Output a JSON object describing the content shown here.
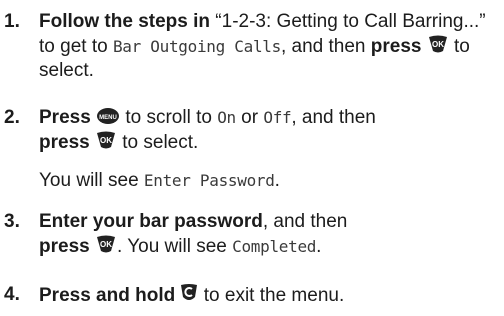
{
  "steps": [
    {
      "num": "1.",
      "lead": "Follow the steps in",
      "ref": "“1-2-3: Getting to Call Barring...” to get to",
      "screen": "Bar Outgoing Calls",
      "after_screen": ",",
      "line3a": "and then",
      "press": "press",
      "tail": "to select."
    },
    {
      "num": "2.",
      "press": "Press",
      "mid": "to scroll to",
      "opt_on": "On",
      "or": "or",
      "opt_off": "Off",
      "then": ", and then",
      "press2": "press",
      "tail": "to select."
    },
    {
      "num": "3.",
      "lead": "Enter your bar password",
      "then": ", and then",
      "press": "press",
      "see": ". You will see",
      "screen": "Completed",
      "end": "."
    },
    {
      "num": "4.",
      "lead": "Press and hold",
      "tail": "to exit the menu."
    }
  ],
  "note": {
    "text": "You will see",
    "screen": "Enter Password",
    "end": "."
  },
  "keys": {
    "ok_key": "OK",
    "menu_key": "MENU",
    "icon_names": [
      "ok-key-icon",
      "menu-key-icon",
      "clear-back-key-icon"
    ],
    "key_color": "#222222",
    "key_text_color": "#ffffff"
  }
}
